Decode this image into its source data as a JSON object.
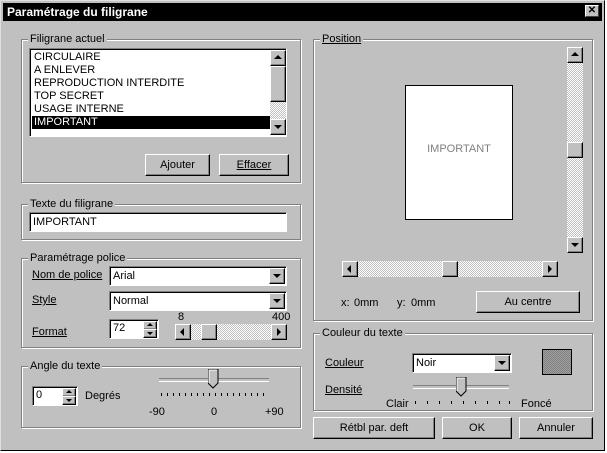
{
  "window": {
    "title": "Paramétrage du filigrane",
    "close_glyph": "✕"
  },
  "filigrane_actuel": {
    "title": "Filigrane actuel",
    "items": [
      "CIRCULAIRE",
      "A ENLEVER",
      "REPRODUCTION INTERDITE",
      "TOP SECRET",
      "USAGE INTERNE",
      "IMPORTANT"
    ],
    "selected_index": 5,
    "add_label": "Ajouter",
    "delete_label": "Effacer"
  },
  "texte_filigrane": {
    "title": "Texte du filigrane",
    "value": "IMPORTANT"
  },
  "police": {
    "title": "Paramétrage police",
    "nom_label": "Nom de police",
    "nom_value": "Arial",
    "style_label": "Style",
    "style_value": "Normal",
    "format_label": "Format",
    "format_value": "72",
    "slider_min": "8",
    "slider_max": "400"
  },
  "angle": {
    "title": "Angle du texte",
    "value": "0",
    "unit": "Degrés",
    "min_label": "-90",
    "mid_label": "0",
    "max_label": "+90"
  },
  "position": {
    "title": "Position",
    "preview_text": "IMPORTANT",
    "x_label": "x:",
    "x_value": "0mm",
    "y_label": "y:",
    "y_value": "0mm",
    "center_label": "Au centre"
  },
  "couleur": {
    "title": "Couleur du texte",
    "couleur_label": "Couleur",
    "couleur_value": "Noir",
    "densite_label": "Densité",
    "clair_label": "Clair",
    "fonce_label": "Foncé"
  },
  "footer": {
    "reset_label": "Rétbl par. deft",
    "ok_label": "OK",
    "cancel_label": "Annuler"
  },
  "colors": {
    "dialog_bg": "#c0c0c0",
    "title_bg": "#000000",
    "selection_bg": "#000000"
  }
}
